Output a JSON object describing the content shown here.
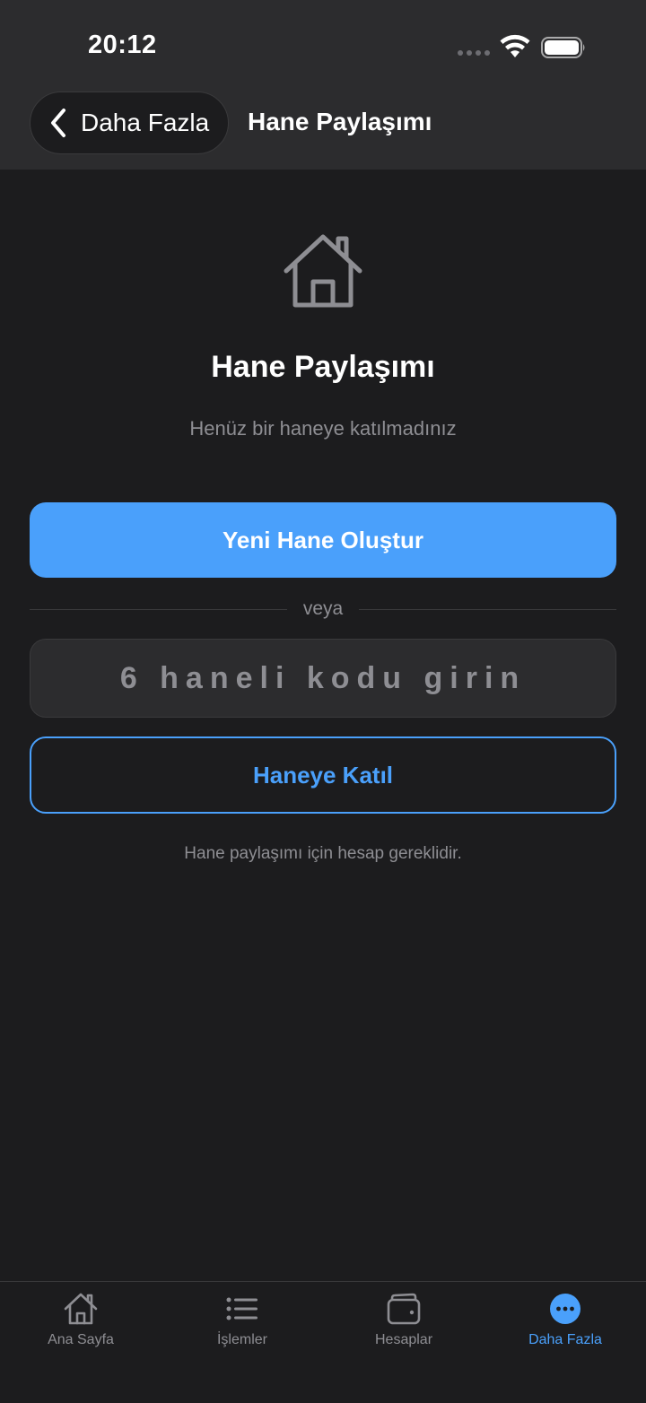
{
  "status_bar": {
    "time": "20:12"
  },
  "nav": {
    "back_label": "Daha Fazla",
    "title": "Hane Paylaşımı"
  },
  "hero": {
    "icon": "house-icon",
    "title": "Hane Paylaşımı",
    "subtitle": "Henüz bir haneye katılmadınız"
  },
  "actions": {
    "create_label": "Yeni Hane Oluştur",
    "divider_text": "veya",
    "code_placeholder": "6 haneli kodu girin",
    "code_value": "",
    "join_label": "Haneye Katıl"
  },
  "footnote": "Hane paylaşımı için hesap gereklidir.",
  "tabbar": {
    "tabs": [
      {
        "label": "Ana Sayfa",
        "icon": "house-icon",
        "active": false
      },
      {
        "label": "İşlemler",
        "icon": "list-icon",
        "active": false
      },
      {
        "label": "Hesaplar",
        "icon": "wallet-icon",
        "active": false
      },
      {
        "label": "Daha Fazla",
        "icon": "more-icon",
        "active": true
      }
    ]
  },
  "colors": {
    "accent": "#4aa0fb",
    "background": "#1c1c1e",
    "surface": "#2c2c2e",
    "secondary_text": "#8e8e93"
  }
}
